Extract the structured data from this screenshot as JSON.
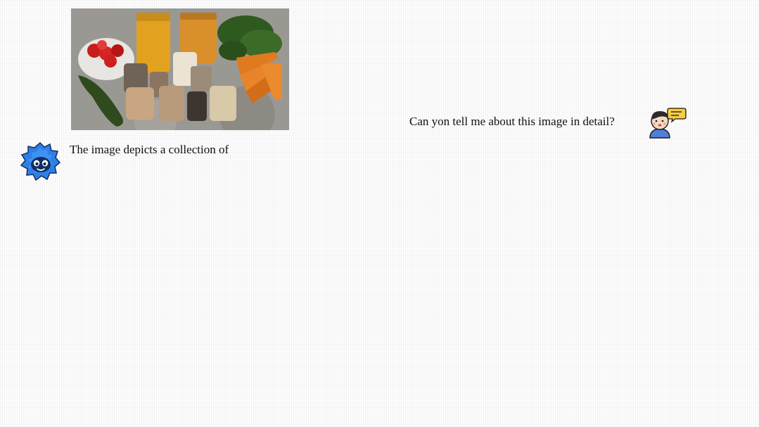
{
  "conversation": {
    "user_message": "Can yon tell me about this image in detail?",
    "assistant_message": "The image depicts a collection of"
  },
  "icons": {
    "user_avatar": "user-speech-bubble-icon",
    "assistant_avatar": "blue-mascot-icon"
  }
}
